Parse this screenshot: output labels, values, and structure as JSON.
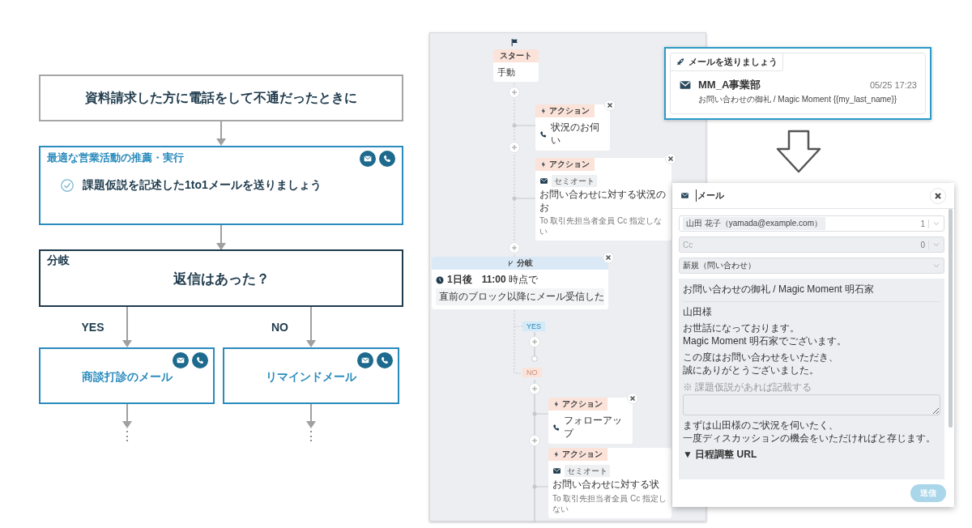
{
  "flowchart": {
    "trigger": "資料請求した方に電話をして不通だったときに",
    "recommendation": {
      "title": "最適な営業活動の推薦・実行",
      "task": "課題仮説を記述した1to1メールを送りましょう"
    },
    "branch": {
      "title": "分岐",
      "question": "返信はあった？"
    },
    "outcomes": [
      {
        "label": "YES",
        "action": "商談打診のメール",
        "more": "⋮"
      },
      {
        "label": "NO",
        "action": "リマインドメール",
        "more": "⋮"
      }
    ]
  },
  "workflow": {
    "start": {
      "header": "スタート",
      "body": "手動"
    },
    "steps": [
      {
        "kind": "call",
        "header": "アクション",
        "title": "状況のお伺い"
      },
      {
        "kind": "mail",
        "header": "アクション",
        "mode": "セミオート",
        "title": "お問い合わせに対する状況のお",
        "recipients": "To 取引先担当者全員 Cc 指定しない"
      }
    ],
    "branch": {
      "header": "分岐",
      "timing": "**1日後　11:00** 時点で",
      "condition": "直前のブロック以降にメール受信した"
    },
    "yes_label": "YES",
    "no_label": "NO",
    "no_steps": [
      {
        "kind": "call",
        "header": "アクション",
        "title": "フォローアップ"
      },
      {
        "kind": "mail",
        "header": "アクション",
        "mode": "セミオート",
        "title": "お問い合わせに対する状",
        "recipients": "To 取引先担当者全員 Cc 指定しない"
      }
    ]
  },
  "suggestion": {
    "tag": "メールを送りましょう",
    "sender": "MM_A事業部",
    "time": "05/25 17:23",
    "subject": "お問い合わせの御礼 / Magic Moment {{my_last_name}}"
  },
  "mail_dialog": {
    "title": "メール",
    "to": {
      "chip": "山田 花子（yamada@example.com）",
      "count": "1"
    },
    "cc": {
      "placeholder": "Cc",
      "count": "0",
      "disabled": true
    },
    "template": "新規（問い合わせ）",
    "subject": "お問い合わせの御礼 / Magic Moment 明石家",
    "body": [
      {
        "kind": "text",
        "lines": [
          "山田様"
        ]
      },
      {
        "kind": "text",
        "lines": [
          "お世話になっております。",
          "Magic Moment 明石家でございます。"
        ]
      },
      {
        "kind": "text",
        "lines": [
          "この度はお問い合わせをいただき、",
          "誠にありがとうございました。"
        ]
      },
      {
        "kind": "hint",
        "text": "※ 課題仮説があれば記載する"
      },
      {
        "kind": "textarea"
      },
      {
        "kind": "text",
        "lines": [
          "まずは山田様のご状況を伺いたく、",
          "一度ディスカッションの機会をいただければと存じます。"
        ]
      },
      {
        "kind": "disclosure",
        "text": "▼ 日程調整 URL"
      }
    ],
    "send": {
      "label": "送信",
      "disabled": true
    }
  }
}
